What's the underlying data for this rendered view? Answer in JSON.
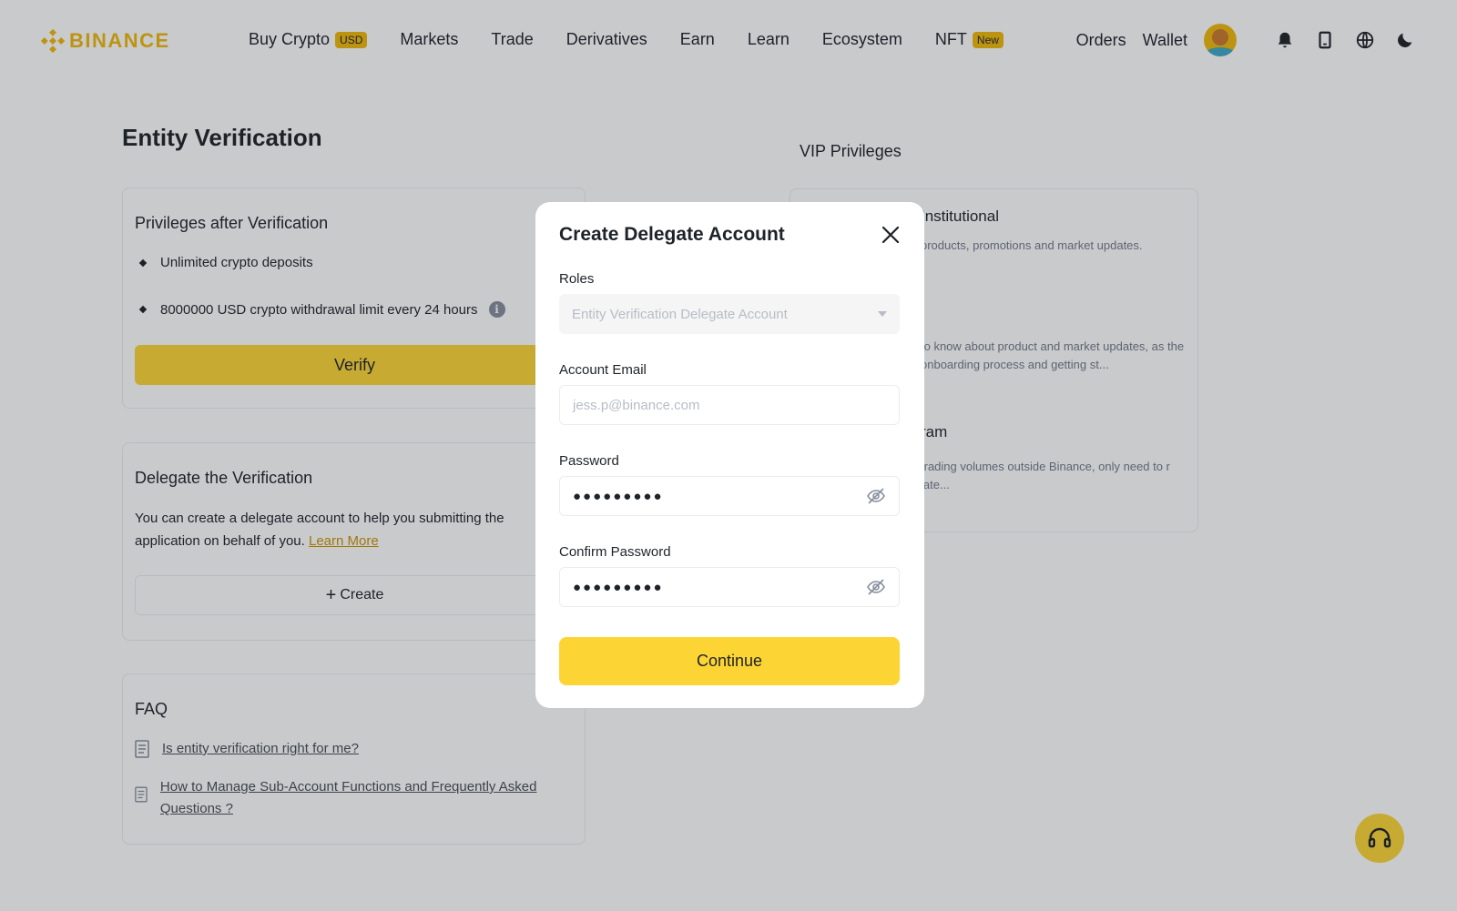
{
  "brand": {
    "name": "BINANCE",
    "accent": "#f0b90b",
    "button_yellow": "#fcd535"
  },
  "nav": {
    "items": [
      {
        "label": "Buy Crypto",
        "badge": "USD"
      },
      {
        "label": "Markets"
      },
      {
        "label": "Trade"
      },
      {
        "label": "Derivatives"
      },
      {
        "label": "Earn"
      },
      {
        "label": "Learn"
      },
      {
        "label": "Ecosystem"
      },
      {
        "label": "NFT",
        "badge": "New"
      }
    ],
    "right": {
      "orders": "Orders",
      "wallet": "Wallet"
    },
    "icons": [
      "avatar",
      "bell-icon",
      "download-icon",
      "globe-icon",
      "moon-icon"
    ]
  },
  "page": {
    "title": "Entity Verification",
    "vip_title": "VIP Privileges"
  },
  "privileges": {
    "heading": "Privileges after Verification",
    "items": [
      "Unlimited crypto deposits",
      "8000000 USD crypto withdrawal limit every 24 hours"
    ],
    "verify_label": "Verify"
  },
  "delegate": {
    "heading": "Delegate the Verification",
    "text": "You can create a delegate account to help you submitting the application on behalf of you.",
    "learn_more": "Learn More",
    "create_label": "Create"
  },
  "faq": {
    "heading": "FAQ",
    "items": [
      "Is entity verification right for me?",
      "How to Manage Sub-Account Functions and Frequently Asked Questions ?"
    ]
  },
  "vip": {
    "items": [
      {
        "title": "Institutional",
        "text": "products, promotions and market updates."
      },
      {
        "title": "",
        "text": "to know about product and market updates, as the onboarding process and getting st..."
      },
      {
        "title": "ram",
        "text": "trading volumes outside Binance, only need to r late..."
      }
    ]
  },
  "modal": {
    "title": "Create Delegate Account",
    "roles_label": "Roles",
    "roles_value": "Entity Verification Delegate Account",
    "email_label": "Account Email",
    "email_placeholder": "jess.p@binance.com",
    "password_label": "Password",
    "password_value": "●●●●●●●●●",
    "confirm_label": "Confirm Password",
    "confirm_value": "●●●●●●●●●",
    "continue_label": "Continue"
  }
}
